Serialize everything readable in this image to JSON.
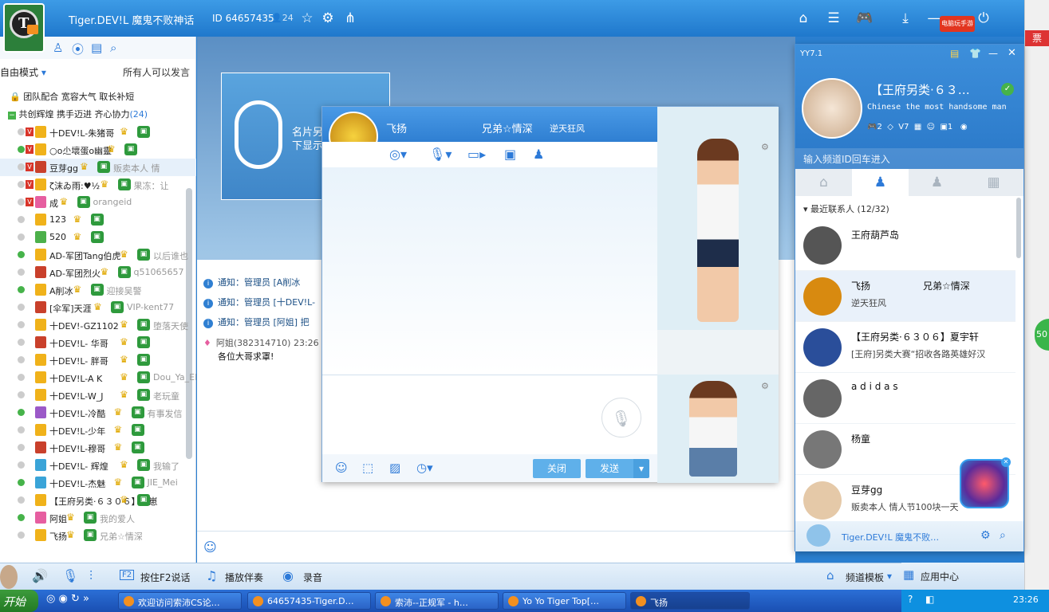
{
  "window": {
    "title": "Tiger.DEV!L 魔鬼不败神话",
    "channel_id": "ID 64657435",
    "users": "24",
    "dot_badge": "●"
  },
  "left": {
    "mode": "自由模式",
    "permission": "所有人可以发言",
    "groups": [
      {
        "name": "团队配合 宽容大气 取长补短"
      },
      {
        "name": "共创辉煌 携手迈进 齐心协力",
        "count": "(24)"
      }
    ],
    "members": [
      {
        "name": "十DEV!L-朱猪哥",
        "tag": ""
      },
      {
        "name": "○o尐壞蛋o幽靈",
        "tag": ""
      },
      {
        "name": "豆芽gg",
        "tag": "贩卖本人 情"
      },
      {
        "name": "ζ沫ゐ雨:♥½",
        "tag": "果冻：让"
      },
      {
        "name": "成",
        "tag": "orangeid"
      },
      {
        "name": "123",
        "tag": ""
      },
      {
        "name": "520",
        "tag": ""
      },
      {
        "name": "AD-军团Tang伯虎",
        "tag": "以后谁也"
      },
      {
        "name": "AD-军团烈火",
        "tag": "q51065657"
      },
      {
        "name": "A削冰",
        "tag": "迎接吴警"
      },
      {
        "name": "[伞军]天涯",
        "tag": "VIP-kent77"
      },
      {
        "name": "十DEV!-GZ1102",
        "tag": "堕落天使"
      },
      {
        "name": "十DEV!L- 华哥",
        "tag": ""
      },
      {
        "name": "十DEV!L- 胖哥",
        "tag": ""
      },
      {
        "name": "十DEV!L-A K",
        "tag": "Dou_Ya_ER"
      },
      {
        "name": "十DEV!L-W_J",
        "tag": "老玩童"
      },
      {
        "name": "十DEV!L-冷酷",
        "tag": "有事发信"
      },
      {
        "name": "十DEV!L-少年",
        "tag": ""
      },
      {
        "name": "十DEV!L-穆哥",
        "tag": ""
      },
      {
        "name": "十DEV!L- 辉煌",
        "tag": "我输了"
      },
      {
        "name": "十DEV!L-杰魅",
        "tag": "JIE_Mei"
      },
      {
        "name": "【王府另类·６３０６】崽崽",
        "tag": ""
      },
      {
        "name": "阿姐",
        "tag": "我的爱人"
      },
      {
        "name": "飞扬",
        "tag": "兄弟☆情深"
      }
    ]
  },
  "center": {
    "mic_text": "名片另\n下显示",
    "notices": [
      "通知：管理员 [A削冰",
      "通知：管理员 [十DEV!L-",
      "通知：管理员 [阿姐] 把"
    ],
    "message": {
      "sender": "阿姐(382314710) 23:26",
      "text": "各位大哥求罩!"
    }
  },
  "bottom": {
    "f2": "F2",
    "ptt": "按住F2说话",
    "accompany": "播放伴奏",
    "record": "录音",
    "template": "频道模板",
    "appcenter": "应用中心"
  },
  "private_chat": {
    "name": "飞扬",
    "signature": "兄弟☆情深",
    "status": "逆天狂风",
    "close": "关闭",
    "send": "发送"
  },
  "right_panel": {
    "app": "YY7.1",
    "nickname": "【王府另类·６３…",
    "motto": "Chinese the most handsome man",
    "stats": [
      "2",
      "",
      "7",
      "",
      "",
      "1"
    ],
    "search_placeholder": "输入频道ID回车进入",
    "recent": "最近联系人 (12/32)",
    "contacts": [
      {
        "name": "王府葫芦岛",
        "sub": ""
      },
      {
        "name": "飞扬",
        "sub": "逆天狂风",
        "extra": "兄弟☆情深"
      },
      {
        "name": "【王府另类·６３０６】夏宇轩",
        "sub": "[王府]另类大赛“招收各路英雄好汉"
      },
      {
        "name": "a d i d a s",
        "sub": ""
      },
      {
        "name": "杨童",
        "sub": ""
      },
      {
        "name": "豆芽gg",
        "sub": "贩卖本人 情人节100块一天"
      }
    ],
    "footer": "Tiger.DEV!L 魔鬼不败…"
  },
  "taskbar": {
    "start": "开始",
    "tasks": [
      "欢迎访问索沛CS论…",
      "64657435-Tiger.D…",
      "索沛--正规军 - h…",
      "Yo Yo Tiger Top[…",
      "飞扬"
    ],
    "clock": "23:26"
  },
  "side_badge": "50",
  "banner": "电脑玩手游",
  "colors": {
    "accent": "#2d7ad8",
    "titlebar": "#2f86d8",
    "online": "#46b34a"
  }
}
